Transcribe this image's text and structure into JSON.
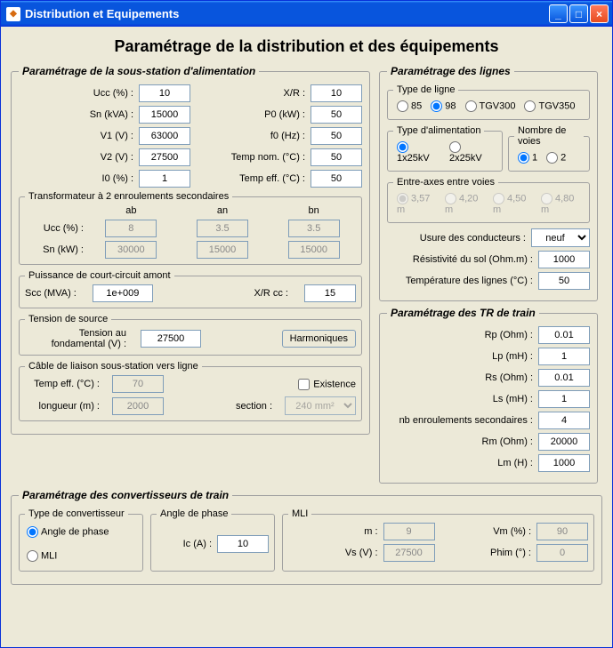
{
  "window": {
    "title": "Distribution et Equipements"
  },
  "page": {
    "title": "Paramétrage de la distribution et des équipements"
  },
  "substation": {
    "legend": "Paramétrage de la sous-station d'alimentation",
    "ucc_lbl": "Ucc (%) :",
    "ucc": "10",
    "sn_lbl": "Sn (kVA) :",
    "sn": "15000",
    "v1_lbl": "V1 (V) :",
    "v1": "63000",
    "v2_lbl": "V2 (V) :",
    "v2": "27500",
    "i0_lbl": "I0 (%) :",
    "i0": "1",
    "xr_lbl": "X/R :",
    "xr": "10",
    "p0_lbl": "P0 (kW) :",
    "p0": "50",
    "f0_lbl": "f0 (Hz) :",
    "f0": "50",
    "tnom_lbl": "Temp nom. (°C) :",
    "tnom": "50",
    "teff_lbl": "Temp eff. (°C) :",
    "teff": "50",
    "xfmr": {
      "legend": "Transformateur à 2 enroulements secondaires",
      "ab": "ab",
      "an": "an",
      "bn": "bn",
      "ucc_lbl": "Ucc (%) :",
      "ucc_ab": "8",
      "ucc_an": "3.5",
      "ucc_bn": "3.5",
      "sn_lbl": "Sn (kW) :",
      "sn_ab": "30000",
      "sn_an": "15000",
      "sn_bn": "15000"
    },
    "scc": {
      "legend": "Puissance de court-circuit amont",
      "scc_lbl": "Scc (MVA) :",
      "scc": "1e+009",
      "xrcc_lbl": "X/R cc :",
      "xrcc": "15"
    },
    "source": {
      "legend": "Tension de source",
      "fund_lbl": "Tension au fondamental (V) :",
      "fund": "27500",
      "harm_btn": "Harmoniques"
    },
    "cable": {
      "legend": "Câble de liaison sous-station vers ligne",
      "teff_lbl": "Temp eff. (°C) :",
      "teff": "70",
      "exist_lbl": "Existence",
      "len_lbl": "longueur (m) :",
      "len": "2000",
      "sec_lbl": "section :",
      "sec": "240 mm²"
    }
  },
  "lines": {
    "legend": "Paramétrage des lignes",
    "type": {
      "legend": "Type de ligne",
      "o1": "85",
      "o2": "98",
      "o3": "TGV300",
      "o4": "TGV350"
    },
    "feed": {
      "legend": "Type d'alimentation",
      "o1": "1x25kV",
      "o2": "2x25kV"
    },
    "tracks": {
      "legend": "Nombre de voies",
      "o1": "1",
      "o2": "2"
    },
    "gap": {
      "legend": "Entre-axes entre voies",
      "o1": "3,57 m",
      "o2": "4,20 m",
      "o3": "4,50 m",
      "o4": "4,80 m"
    },
    "wear_lbl": "Usure des conducteurs :",
    "wear": "neuf",
    "resist_lbl": "Résistivité du sol (Ohm.m) :",
    "resist": "1000",
    "temp_lbl": "Température des lignes  (°C) :",
    "temp": "50"
  },
  "traintr": {
    "legend": "Paramétrage des TR de train",
    "rp_lbl": "Rp (Ohm) :",
    "rp": "0.01",
    "lp_lbl": "Lp (mH) :",
    "lp": "1",
    "rs_lbl": "Rs (Ohm) :",
    "rs": "0.01",
    "ls_lbl": "Ls (mH) :",
    "ls": "1",
    "nbenr_lbl": "nb enroulements secondaires :",
    "nbenr": "4",
    "rm_lbl": "Rm (Ohm) :",
    "rm": "20000",
    "lm_lbl": "Lm (H) :",
    "lm": "1000"
  },
  "conv": {
    "legend": "Paramétrage des convertisseurs de train",
    "type": {
      "legend": "Type de convertisseur",
      "o1": "Angle de phase",
      "o2": "MLI"
    },
    "phase": {
      "legend": "Angle de phase",
      "ic_lbl": "Ic (A) :",
      "ic": "10"
    },
    "mli": {
      "legend": "MLI",
      "m_lbl": "m :",
      "m": "9",
      "vm_lbl": "Vm (%) :",
      "vm": "90",
      "vs_lbl": "Vs (V) :",
      "vs": "27500",
      "phim_lbl": "Phim (°) :",
      "phim": "0"
    }
  }
}
